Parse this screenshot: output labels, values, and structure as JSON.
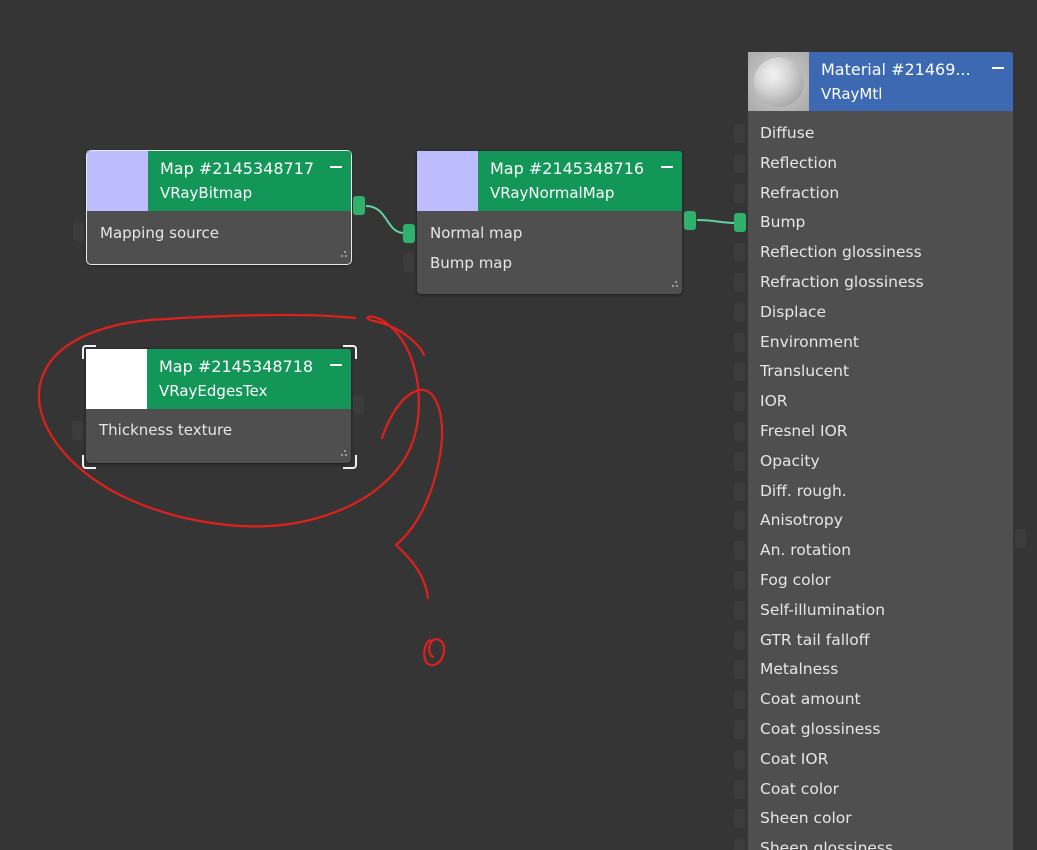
{
  "nodes": {
    "bitmap": {
      "title": "Map #2145348717",
      "type": "VRayBitmap",
      "swatch_color": "#bcbcff",
      "inputs": [
        "Mapping source"
      ]
    },
    "normal": {
      "title": "Map #2145348716",
      "type": "VRayNormalMap",
      "swatch_color": "#bcbcff",
      "inputs": [
        "Normal map",
        "Bump map"
      ]
    },
    "edges": {
      "title": "Map #2145348718",
      "type": "VRayEdgesTex",
      "swatch_color": "#ffffff",
      "inputs": [
        "Thickness texture"
      ]
    }
  },
  "material": {
    "title": "Material #21469...",
    "type": "VRayMtl",
    "header_color": "#3d68b2",
    "inputs": [
      "Diffuse",
      "Reflection",
      "Refraction",
      "Bump",
      "Reflection glossiness",
      "Refraction glossiness",
      "Displace",
      "Environment",
      "Translucent",
      "IOR",
      "Fresnel IOR",
      "Opacity",
      "Diff. rough.",
      "Anisotropy",
      "An. rotation",
      "Fog color",
      "Self-illumination",
      "GTR tail falloff",
      "Metalness",
      "Coat amount",
      "Coat glossiness",
      "Coat IOR",
      "Coat color",
      "Sheen color",
      "Sheen glossiness"
    ]
  },
  "colors": {
    "canvas_bg": "#353535",
    "node_body": "#4f4f4f",
    "map_header": "#139758",
    "wire": "#5fd3a0",
    "annotation": "#e0201c"
  }
}
